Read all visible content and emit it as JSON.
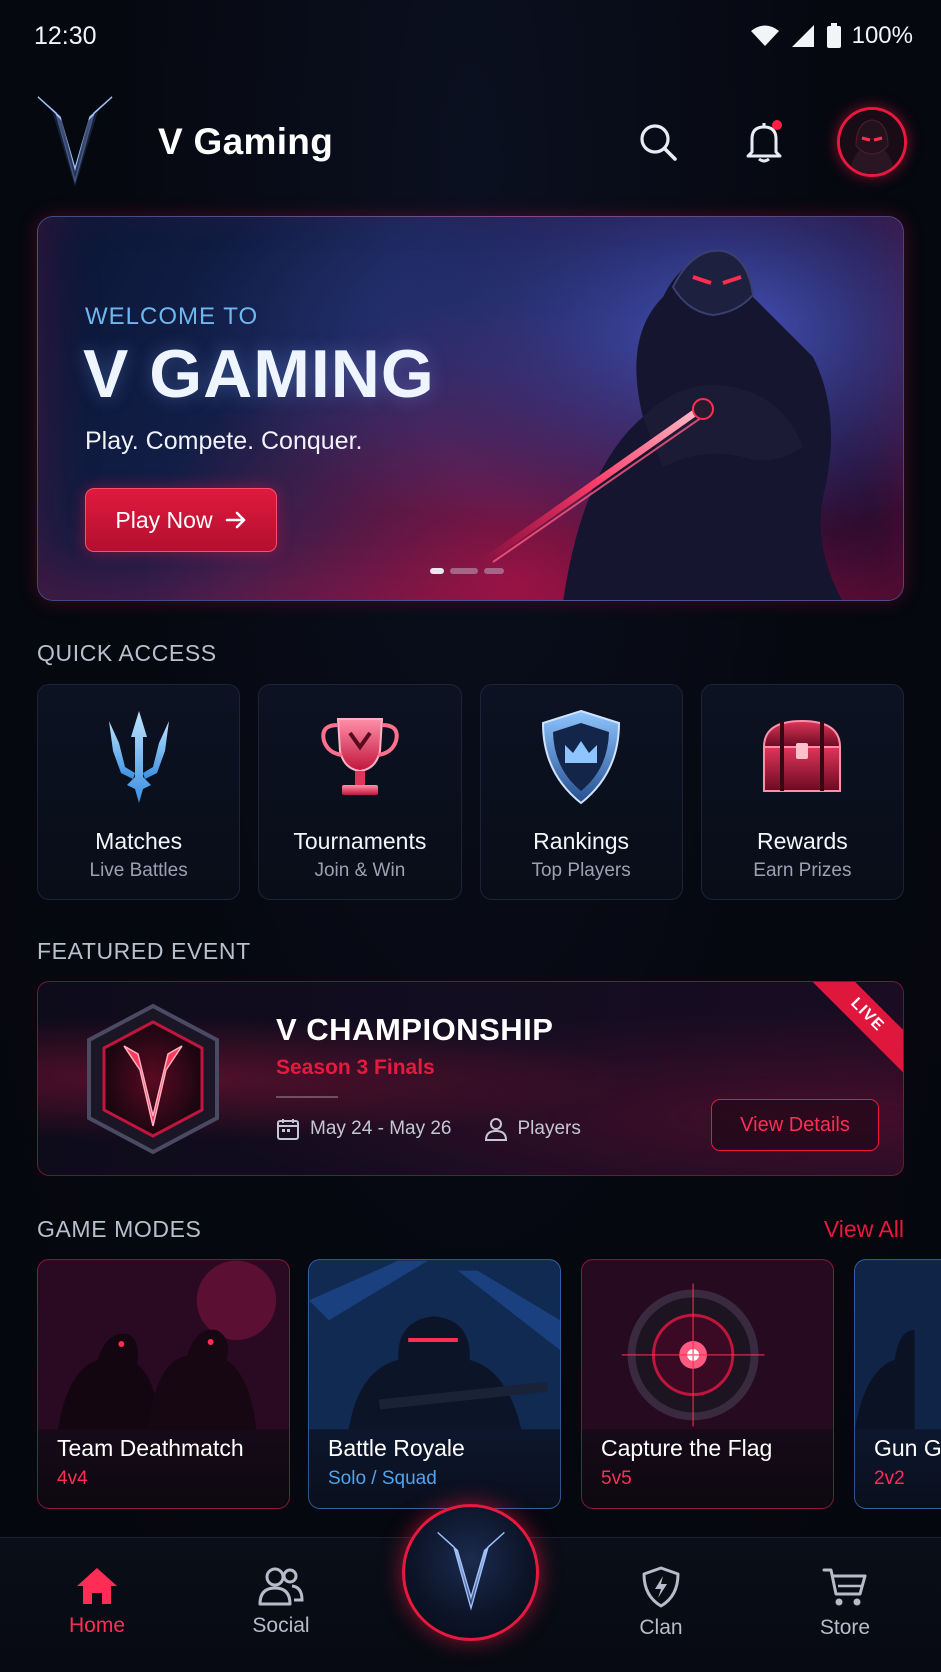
{
  "status_bar": {
    "time": "12:30",
    "battery": "100%"
  },
  "header": {
    "app_title": "V Gaming"
  },
  "hero": {
    "eyebrow": "WELCOME TO",
    "title": "V GAMING",
    "tagline": "Play. Compete. Conquer.",
    "cta_label": "Play Now",
    "slides_total": 3,
    "active_slide": 1
  },
  "quick_access": {
    "title": "QUICK ACCESS",
    "items": [
      {
        "label": "Matches",
        "sub": "Live Battles",
        "icon": "trident-icon"
      },
      {
        "label": "Tournaments",
        "sub": "Join & Win",
        "icon": "trophy-icon"
      },
      {
        "label": "Rankings",
        "sub": "Top Players",
        "icon": "shield-crown-icon"
      },
      {
        "label": "Rewards",
        "sub": "Earn Prizes",
        "icon": "treasure-chest-icon"
      }
    ]
  },
  "featured": {
    "title": "FEATURED EVENT",
    "event_title": "V CHAMPIONSHIP",
    "event_sub": "Season 3 Finals",
    "dates": "May 24 - May 26",
    "players": "Players",
    "details_label": "View Details",
    "badge": "LIVE"
  },
  "game_modes": {
    "title": "GAME MODES",
    "view_all": "View All",
    "items": [
      {
        "name": "Team Deathmatch",
        "players": "4v4"
      },
      {
        "name": "Battle Royale",
        "players": "Solo / Squad"
      },
      {
        "name": "Capture the Flag",
        "players": "5v5"
      },
      {
        "name": "Gun Gi",
        "players": "2v2"
      }
    ]
  },
  "nav": {
    "items": [
      {
        "label": "Home",
        "icon": "home-icon"
      },
      {
        "label": "Social",
        "icon": "users-icon"
      },
      {
        "label": "Clan",
        "icon": "shield-icon"
      },
      {
        "label": "Store",
        "icon": "cart-icon"
      }
    ]
  },
  "colors": {
    "accent": "#e8183f",
    "blue_accent": "#4fa3ef",
    "background": "#060810"
  }
}
